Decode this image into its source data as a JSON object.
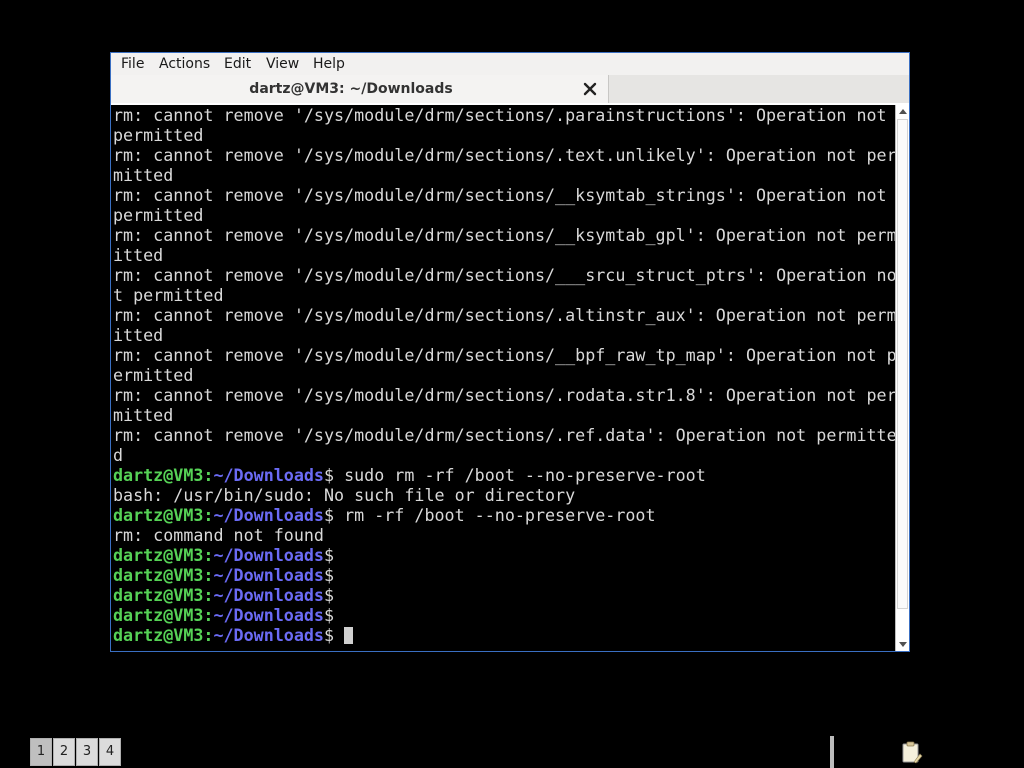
{
  "window": {
    "menu": [
      "File",
      "Actions",
      "Edit",
      "View",
      "Help"
    ],
    "tab_title": "dartz@VM3: ~/Downloads"
  },
  "terminal": {
    "prompt_user": "dartz@VM3",
    "prompt_path": "~/Downloads",
    "prompt_sep": ":",
    "prompt_end": "$",
    "lines": [
      {
        "type": "out",
        "text": "rm: cannot remove '/sys/module/drm/sections/.parainstructions': Operation not"
      },
      {
        "type": "out",
        "text": "permitted"
      },
      {
        "type": "out",
        "text": "rm: cannot remove '/sys/module/drm/sections/.text.unlikely': Operation not per"
      },
      {
        "type": "out",
        "text": "mitted"
      },
      {
        "type": "out",
        "text": "rm: cannot remove '/sys/module/drm/sections/__ksymtab_strings': Operation not"
      },
      {
        "type": "out",
        "text": "permitted"
      },
      {
        "type": "out",
        "text": "rm: cannot remove '/sys/module/drm/sections/__ksymtab_gpl': Operation not perm"
      },
      {
        "type": "out",
        "text": "itted"
      },
      {
        "type": "out",
        "text": "rm: cannot remove '/sys/module/drm/sections/___srcu_struct_ptrs': Operation no"
      },
      {
        "type": "out",
        "text": "t permitted"
      },
      {
        "type": "out",
        "text": "rm: cannot remove '/sys/module/drm/sections/.altinstr_aux': Operation not perm"
      },
      {
        "type": "out",
        "text": "itted"
      },
      {
        "type": "out",
        "text": "rm: cannot remove '/sys/module/drm/sections/__bpf_raw_tp_map': Operation not p"
      },
      {
        "type": "out",
        "text": "ermitted"
      },
      {
        "type": "out",
        "text": "rm: cannot remove '/sys/module/drm/sections/.rodata.str1.8': Operation not per"
      },
      {
        "type": "out",
        "text": "mitted"
      },
      {
        "type": "out",
        "text": "rm: cannot remove '/sys/module/drm/sections/.ref.data': Operation not permitte"
      },
      {
        "type": "out",
        "text": "d"
      },
      {
        "type": "cmd",
        "text": " sudo rm -rf /boot --no-preserve-root"
      },
      {
        "type": "out",
        "text": "bash: /usr/bin/sudo: No such file or directory"
      },
      {
        "type": "cmd",
        "text": " rm -rf /boot --no-preserve-root"
      },
      {
        "type": "out",
        "text": "rm: command not found"
      },
      {
        "type": "cmd",
        "text": ""
      },
      {
        "type": "cmd",
        "text": ""
      },
      {
        "type": "cmd",
        "text": ""
      },
      {
        "type": "cmd",
        "text": ""
      },
      {
        "type": "cmd",
        "text": " ",
        "cursor": true
      }
    ]
  },
  "taskbar": {
    "workspaces": [
      "1",
      "2",
      "3",
      "4"
    ],
    "active_workspace": "1"
  },
  "colors": {
    "prompt_user": "#56d256",
    "prompt_path": "#6b6bf5",
    "window_border": "#3a6fc2"
  },
  "icons": {
    "tab_close": "close-icon",
    "scroll_up": "arrow-up-icon",
    "scroll_down": "arrow-down-icon",
    "tray": "clipboard-icon"
  }
}
